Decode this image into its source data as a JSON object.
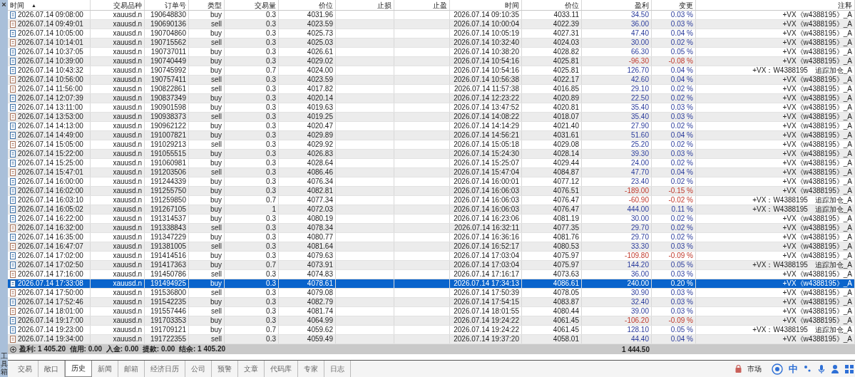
{
  "sidebar": {
    "close": "×",
    "title": "工具箱"
  },
  "columns": [
    {
      "label": "时间",
      "sort_mark": "▲"
    },
    {
      "label": "交易品种"
    },
    {
      "label": "订单号"
    },
    {
      "label": "类型"
    },
    {
      "label": "交易量"
    },
    {
      "label": "价位"
    },
    {
      "label": "止损"
    },
    {
      "label": "止盈"
    },
    {
      "label": "时间"
    },
    {
      "label": "价位"
    },
    {
      "label": "盈利"
    },
    {
      "label": "变更"
    },
    {
      "label": "注释"
    }
  ],
  "rows": [
    {
      "kind": "buy",
      "open_time": "2026.07.14 09:08:00",
      "symbol": "xauusd.n",
      "order": "190648830",
      "type": "buy",
      "volume": "0.3",
      "open_price": "4031.96",
      "close_time": "2026.07.14 09:10:35",
      "close_price": "4033.11",
      "profit": "34.50",
      "change": "0.03 %",
      "loss": false,
      "comment": "+VX《w4388195》_A",
      "selected": false
    },
    {
      "kind": "sell",
      "open_time": "2026.07.14 09:49:01",
      "symbol": "xauusd.n",
      "order": "190690136",
      "type": "sell",
      "volume": "0.3",
      "open_price": "4023.59",
      "close_time": "2026.07.14 10:00:04",
      "close_price": "4022.39",
      "profit": "36.00",
      "change": "0.03 %",
      "loss": false,
      "comment": "+VX《w4388195》_A",
      "selected": false
    },
    {
      "kind": "buy",
      "open_time": "2026.07.14 10:05:00",
      "symbol": "xauusd.n",
      "order": "190704860",
      "type": "buy",
      "volume": "0.3",
      "open_price": "4025.73",
      "close_time": "2026.07.14 10:05:19",
      "close_price": "4027.31",
      "profit": "47.40",
      "change": "0.04 %",
      "loss": false,
      "comment": "+VX《w4388195》_A",
      "selected": false
    },
    {
      "kind": "sell",
      "open_time": "2026.07.14 10:14:01",
      "symbol": "xauusd.n",
      "order": "190715562",
      "type": "sell",
      "volume": "0.3",
      "open_price": "4025.03",
      "close_time": "2026.07.14 10:32:40",
      "close_price": "4024.03",
      "profit": "30.00",
      "change": "0.02 %",
      "loss": false,
      "comment": "+VX《w4388195》_A",
      "selected": false
    },
    {
      "kind": "buy",
      "open_time": "2026.07.14 10:37:05",
      "symbol": "xauusd.n",
      "order": "190737011",
      "type": "buy",
      "volume": "0.3",
      "open_price": "4026.61",
      "close_time": "2026.07.14 10:38:20",
      "close_price": "4028.82",
      "profit": "66.30",
      "change": "0.05 %",
      "loss": false,
      "comment": "+VX《w4388195》_A",
      "selected": false
    },
    {
      "kind": "buy",
      "open_time": "2026.07.14 10:39:00",
      "symbol": "xauusd.n",
      "order": "190740449",
      "type": "buy",
      "volume": "0.3",
      "open_price": "4029.02",
      "close_time": "2026.07.14 10:54:16",
      "close_price": "4025.81",
      "profit": "-96.30",
      "change": "-0.08 %",
      "loss": true,
      "comment": "+VX《w4388195》_A",
      "selected": false
    },
    {
      "kind": "buy",
      "open_time": "2026.07.14 10:43:32",
      "symbol": "xauusd.n",
      "order": "190745992",
      "type": "buy",
      "volume": "0.7",
      "open_price": "4024.00",
      "close_time": "2026.07.14 10:54:16",
      "close_price": "4025.81",
      "profit": "126.70",
      "change": "0.04 %",
      "loss": false,
      "comment": "+VX：W4388195　追踪加仓_A",
      "selected": false
    },
    {
      "kind": "sell",
      "open_time": "2026.07.14 10:56:00",
      "symbol": "xauusd.n",
      "order": "190757411",
      "type": "sell",
      "volume": "0.3",
      "open_price": "4023.59",
      "close_time": "2026.07.14 10:56:38",
      "close_price": "4022.17",
      "profit": "42.60",
      "change": "0.04 %",
      "loss": false,
      "comment": "+VX《w4388195》_A",
      "selected": false
    },
    {
      "kind": "sell",
      "open_time": "2026.07.14 11:56:00",
      "symbol": "xauusd.n",
      "order": "190822861",
      "type": "sell",
      "volume": "0.3",
      "open_price": "4017.82",
      "close_time": "2026.07.14 11:57:38",
      "close_price": "4016.85",
      "profit": "29.10",
      "change": "0.02 %",
      "loss": false,
      "comment": "+VX《w4388195》_A",
      "selected": false
    },
    {
      "kind": "buy",
      "open_time": "2026.07.14 12:07:39",
      "symbol": "xauusd.n",
      "order": "190837349",
      "type": "buy",
      "volume": "0.3",
      "open_price": "4020.14",
      "close_time": "2026.07.14 12:23:22",
      "close_price": "4020.89",
      "profit": "22.50",
      "change": "0.02 %",
      "loss": false,
      "comment": "+VX《w4388195》_A",
      "selected": false
    },
    {
      "kind": "buy",
      "open_time": "2026.07.14 13:11:00",
      "symbol": "xauusd.n",
      "order": "190901598",
      "type": "buy",
      "volume": "0.3",
      "open_price": "4019.63",
      "close_time": "2026.07.14 13:47:52",
      "close_price": "4020.81",
      "profit": "35.40",
      "change": "0.03 %",
      "loss": false,
      "comment": "+VX《w4388195》_A",
      "selected": false
    },
    {
      "kind": "sell",
      "open_time": "2026.07.14 13:53:00",
      "symbol": "xauusd.n",
      "order": "190938373",
      "type": "sell",
      "volume": "0.3",
      "open_price": "4019.25",
      "close_time": "2026.07.14 14:08:22",
      "close_price": "4018.07",
      "profit": "35.40",
      "change": "0.03 %",
      "loss": false,
      "comment": "+VX《w4388195》_A",
      "selected": false
    },
    {
      "kind": "buy",
      "open_time": "2026.07.14 14:13:00",
      "symbol": "xauusd.n",
      "order": "190962122",
      "type": "buy",
      "volume": "0.3",
      "open_price": "4020.47",
      "close_time": "2026.07.14 14:14:29",
      "close_price": "4021.40",
      "profit": "27.90",
      "change": "0.02 %",
      "loss": false,
      "comment": "+VX《w4388195》_A",
      "selected": false
    },
    {
      "kind": "buy",
      "open_time": "2026.07.14 14:49:00",
      "symbol": "xauusd.n",
      "order": "191007821",
      "type": "buy",
      "volume": "0.3",
      "open_price": "4029.89",
      "close_time": "2026.07.14 14:56:21",
      "close_price": "4031.61",
      "profit": "51.60",
      "change": "0.04 %",
      "loss": false,
      "comment": "+VX《w4388195》_A",
      "selected": false
    },
    {
      "kind": "sell",
      "open_time": "2026.07.14 15:05:00",
      "symbol": "xauusd.n",
      "order": "191029213",
      "type": "sell",
      "volume": "0.3",
      "open_price": "4029.92",
      "close_time": "2026.07.14 15:05:18",
      "close_price": "4029.08",
      "profit": "25.20",
      "change": "0.02 %",
      "loss": false,
      "comment": "+VX《w4388195》_A",
      "selected": false
    },
    {
      "kind": "buy",
      "open_time": "2026.07.14 15:22:00",
      "symbol": "xauusd.n",
      "order": "191055515",
      "type": "buy",
      "volume": "0.3",
      "open_price": "4026.83",
      "close_time": "2026.07.14 15:24:30",
      "close_price": "4028.14",
      "profit": "39.30",
      "change": "0.03 %",
      "loss": false,
      "comment": "+VX《w4388195》_A",
      "selected": false
    },
    {
      "kind": "buy",
      "open_time": "2026.07.14 15:25:00",
      "symbol": "xauusd.n",
      "order": "191060981",
      "type": "buy",
      "volume": "0.3",
      "open_price": "4028.64",
      "close_time": "2026.07.14 15:25:07",
      "close_price": "4029.44",
      "profit": "24.00",
      "change": "0.02 %",
      "loss": false,
      "comment": "+VX《w4388195》_A",
      "selected": false
    },
    {
      "kind": "sell",
      "open_time": "2026.07.14 15:47:01",
      "symbol": "xauusd.n",
      "order": "191203506",
      "type": "sell",
      "volume": "0.3",
      "open_price": "4086.46",
      "close_time": "2026.07.14 15:47:04",
      "close_price": "4084.87",
      "profit": "47.70",
      "change": "0.04 %",
      "loss": false,
      "comment": "+VX《w4388195》_A",
      "selected": false
    },
    {
      "kind": "buy",
      "open_time": "2026.07.14 16:00:00",
      "symbol": "xauusd.n",
      "order": "191244339",
      "type": "buy",
      "volume": "0.3",
      "open_price": "4076.34",
      "close_time": "2026.07.14 16:00:01",
      "close_price": "4077.12",
      "profit": "23.40",
      "change": "0.02 %",
      "loss": false,
      "comment": "+VX《w4388195》_A",
      "selected": false
    },
    {
      "kind": "buy",
      "open_time": "2026.07.14 16:02:00",
      "symbol": "xauusd.n",
      "order": "191255750",
      "type": "buy",
      "volume": "0.3",
      "open_price": "4082.81",
      "close_time": "2026.07.14 16:06:03",
      "close_price": "4076.51",
      "profit": "-189.00",
      "change": "-0.15 %",
      "loss": true,
      "comment": "+VX《w4388195》_A",
      "selected": false
    },
    {
      "kind": "buy",
      "open_time": "2026.07.14 16:03:10",
      "symbol": "xauusd.n",
      "order": "191259850",
      "type": "buy",
      "volume": "0.7",
      "open_price": "4077.34",
      "close_time": "2026.07.14 16:06:03",
      "close_price": "4076.47",
      "profit": "-60.90",
      "change": "-0.02 %",
      "loss": true,
      "comment": "+VX：W4388195　追踪加仓_A",
      "selected": false
    },
    {
      "kind": "buy",
      "open_time": "2026.07.14 16:05:02",
      "symbol": "xauusd.n",
      "order": "191267105",
      "type": "buy",
      "volume": "1",
      "open_price": "4072.03",
      "close_time": "2026.07.14 16:06:03",
      "close_price": "4076.47",
      "profit": "444.00",
      "change": "0.11 %",
      "loss": false,
      "comment": "+VX：W4388195　追踪加仓_A",
      "selected": false
    },
    {
      "kind": "buy",
      "open_time": "2026.07.14 16:22:00",
      "symbol": "xauusd.n",
      "order": "191314537",
      "type": "buy",
      "volume": "0.3",
      "open_price": "4080.19",
      "close_time": "2026.07.14 16:23:06",
      "close_price": "4081.19",
      "profit": "30.00",
      "change": "0.02 %",
      "loss": false,
      "comment": "+VX《w4388195》_A",
      "selected": false
    },
    {
      "kind": "sell",
      "open_time": "2026.07.14 16:32:00",
      "symbol": "xauusd.n",
      "order": "191338843",
      "type": "sell",
      "volume": "0.3",
      "open_price": "4078.34",
      "close_time": "2026.07.14 16:32:11",
      "close_price": "4077.35",
      "profit": "29.70",
      "change": "0.02 %",
      "loss": false,
      "comment": "+VX《w4388195》_A",
      "selected": false
    },
    {
      "kind": "buy",
      "open_time": "2026.07.14 16:35:00",
      "symbol": "xauusd.n",
      "order": "191347229",
      "type": "buy",
      "volume": "0.3",
      "open_price": "4080.77",
      "close_time": "2026.07.14 16:36:16",
      "close_price": "4081.76",
      "profit": "29.70",
      "change": "0.02 %",
      "loss": false,
      "comment": "+VX《w4388195》_A",
      "selected": false
    },
    {
      "kind": "sell",
      "open_time": "2026.07.14 16:47:07",
      "symbol": "xauusd.n",
      "order": "191381005",
      "type": "sell",
      "volume": "0.3",
      "open_price": "4081.64",
      "close_time": "2026.07.14 16:52:17",
      "close_price": "4080.53",
      "profit": "33.30",
      "change": "0.03 %",
      "loss": false,
      "comment": "+VX《w4388195》_A",
      "selected": false
    },
    {
      "kind": "buy",
      "open_time": "2026.07.14 17:02:00",
      "symbol": "xauusd.n",
      "order": "191414516",
      "type": "buy",
      "volume": "0.3",
      "open_price": "4079.63",
      "close_time": "2026.07.14 17:03:04",
      "close_price": "4075.97",
      "profit": "-109.80",
      "change": "-0.09 %",
      "loss": true,
      "comment": "+VX《w4388195》_A",
      "selected": false
    },
    {
      "kind": "buy",
      "open_time": "2026.07.14 17:02:50",
      "symbol": "xauusd.n",
      "order": "191417363",
      "type": "buy",
      "volume": "0.7",
      "open_price": "4073.91",
      "close_time": "2026.07.14 17:03:04",
      "close_price": "4075.97",
      "profit": "144.20",
      "change": "0.05 %",
      "loss": false,
      "comment": "+VX：W4388195　追踪加仓_A",
      "selected": false
    },
    {
      "kind": "sell",
      "open_time": "2026.07.14 17:16:00",
      "symbol": "xauusd.n",
      "order": "191450786",
      "type": "sell",
      "volume": "0.3",
      "open_price": "4074.83",
      "close_time": "2026.07.14 17:16:17",
      "close_price": "4073.63",
      "profit": "36.00",
      "change": "0.03 %",
      "loss": false,
      "comment": "+VX《w4388195》_A",
      "selected": false
    },
    {
      "kind": "buy",
      "open_time": "2026.07.14 17:33:08",
      "symbol": "xauusd.n",
      "order": "191494925",
      "type": "buy",
      "volume": "0.3",
      "open_price": "4078.61",
      "close_time": "2026.07.14 17:34:13",
      "close_price": "4086.61",
      "profit": "240.00",
      "change": "0.20 %",
      "loss": false,
      "comment": "+VX《w4388195》_A",
      "selected": true
    },
    {
      "kind": "sell",
      "open_time": "2026.07.14 17:50:00",
      "symbol": "xauusd.n",
      "order": "191536800",
      "type": "sell",
      "volume": "0.3",
      "open_price": "4079.08",
      "close_time": "2026.07.14 17:50:39",
      "close_price": "4078.05",
      "profit": "30.90",
      "change": "0.03 %",
      "loss": false,
      "comment": "+VX《w4388195》_A",
      "selected": false
    },
    {
      "kind": "buy",
      "open_time": "2026.07.14 17:52:46",
      "symbol": "xauusd.n",
      "order": "191542235",
      "type": "buy",
      "volume": "0.3",
      "open_price": "4082.79",
      "close_time": "2026.07.14 17:54:15",
      "close_price": "4083.87",
      "profit": "32.40",
      "change": "0.03 %",
      "loss": false,
      "comment": "+VX《w4388195》_A",
      "selected": false
    },
    {
      "kind": "sell",
      "open_time": "2026.07.14 18:01:00",
      "symbol": "xauusd.n",
      "order": "191557446",
      "type": "sell",
      "volume": "0.3",
      "open_price": "4081.74",
      "close_time": "2026.07.14 18:01:55",
      "close_price": "4080.44",
      "profit": "39.00",
      "change": "0.03 %",
      "loss": false,
      "comment": "+VX《w4388195》_A",
      "selected": false
    },
    {
      "kind": "buy",
      "open_time": "2026.07.14 19:17:00",
      "symbol": "xauusd.n",
      "order": "191703353",
      "type": "buy",
      "volume": "0.3",
      "open_price": "4064.99",
      "close_time": "2026.07.14 19:24:22",
      "close_price": "4061.45",
      "profit": "-106.20",
      "change": "-0.09 %",
      "loss": true,
      "comment": "+VX《w4388195》_A",
      "selected": false
    },
    {
      "kind": "buy",
      "open_time": "2026.07.14 19:23:00",
      "symbol": "xauusd.n",
      "order": "191709121",
      "type": "buy",
      "volume": "0.7",
      "open_price": "4059.62",
      "close_time": "2026.07.14 19:24:22",
      "close_price": "4061.45",
      "profit": "128.10",
      "change": "0.05 %",
      "loss": false,
      "comment": "+VX：W4388195　追踪加仓_A",
      "selected": false
    },
    {
      "kind": "sell",
      "open_time": "2026.07.14 19:34:00",
      "symbol": "xauusd.n",
      "order": "191722355",
      "type": "sell",
      "volume": "0.3",
      "open_price": "4059.49",
      "close_time": "2026.07.14 19:37:20",
      "close_price": "4058.01",
      "profit": "44.40",
      "change": "0.04 %",
      "loss": false,
      "comment": "+VX《w4388195》_A",
      "selected": false
    }
  ],
  "summary": {
    "text": "盈利: 1 405.20  信用: 0.00  入金: 0.00  提款: 0.00  结余: 1 405.20",
    "total_profit": "1 444.50"
  },
  "tabs": [
    {
      "label": "交易",
      "selected": false
    },
    {
      "label": "敞口",
      "selected": false
    },
    {
      "label": "历史",
      "selected": true
    },
    {
      "label": "新闻",
      "selected": false
    },
    {
      "label": "邮箱",
      "selected": false
    },
    {
      "label": "经济日历",
      "selected": false
    },
    {
      "label": "公司",
      "selected": false
    },
    {
      "label": "预警",
      "selected": false
    },
    {
      "label": "文章",
      "selected": false
    },
    {
      "label": "代码库",
      "selected": false
    },
    {
      "label": "专家",
      "selected": false
    },
    {
      "label": "日志",
      "selected": false
    }
  ],
  "status": {
    "market": "市场",
    "ime": "中"
  }
}
